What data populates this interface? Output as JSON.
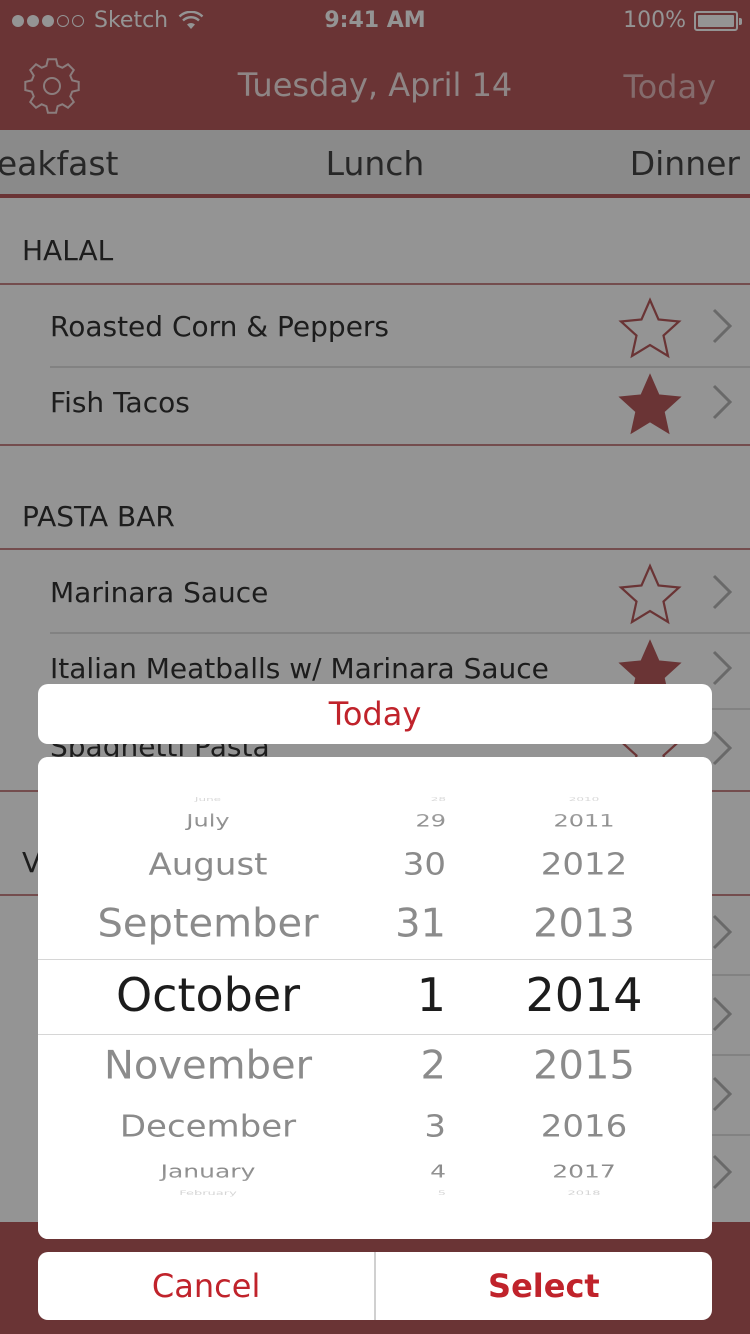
{
  "status_bar": {
    "carrier": "Sketch",
    "time": "9:41 AM",
    "battery": "100%",
    "battery_level": 1.0
  },
  "nav": {
    "title": "Tuesday, April 14",
    "today": "Today",
    "settings_icon": "gear-icon"
  },
  "tabs": [
    "reakfast",
    "Lunch",
    "Dinner"
  ],
  "sections": [
    {
      "title": "HALAL",
      "items": [
        {
          "label": "Roasted Corn & Peppers",
          "favorite": false
        },
        {
          "label": "Fish Tacos",
          "favorite": true
        }
      ]
    },
    {
      "title": "PASTA BAR",
      "items": [
        {
          "label": "Marinara Sauce",
          "favorite": false
        },
        {
          "label": "Italian Meatballs w/ Marinara Sauce",
          "favorite": true
        },
        {
          "label": "Spaghetti Pasta",
          "favorite": false
        }
      ]
    },
    {
      "title": "V",
      "items": []
    }
  ],
  "action_sheet": {
    "today_label": "Today",
    "cancel_label": "Cancel",
    "select_label": "Select"
  },
  "picker": {
    "months": [
      "June",
      "July",
      "August",
      "September",
      "October",
      "November",
      "December",
      "January",
      "February"
    ],
    "days": [
      "28",
      "29",
      "30",
      "31",
      "1",
      "2",
      "3",
      "4",
      "5"
    ],
    "years": [
      "2010",
      "2011",
      "2012",
      "2013",
      "2014",
      "2015",
      "2016",
      "2017",
      "2018"
    ],
    "selected_index": 4
  },
  "colors": {
    "brand": "#b75a5c",
    "accent_text": "#c0232b",
    "star": "#b75a5c"
  }
}
